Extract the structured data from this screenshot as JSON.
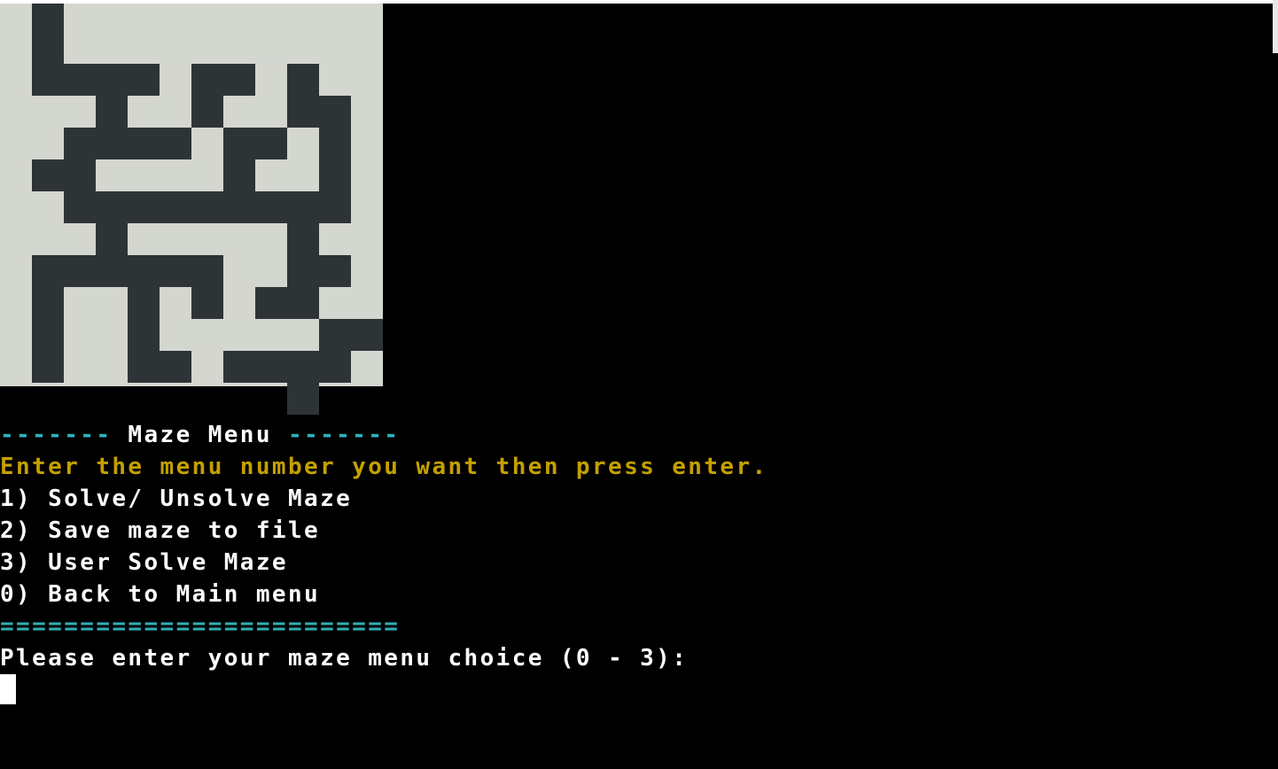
{
  "maze": {
    "cell_size": 36,
    "grid": [
      "............",
      ".#..........",
      ".####.##.#..",
      "...#..#..##.",
      "..####.##.#.",
      ".##....#..#.",
      "..#########.",
      "...#.....#..",
      ".######..##.",
      ".#..#.#.##..",
      ".#..#.....##",
      ".#..##.####.",
      ".........#.."
    ],
    "wall_color": "#2e3436",
    "floor_color": "#d4d6d0"
  },
  "menu": {
    "header_left": "-------",
    "header_title": " Maze Menu ",
    "header_right": "-------",
    "instruction": "Enter the menu number you want then press enter.",
    "options": [
      "1) Solve/ Unsolve Maze",
      "2) Save maze to file",
      "3) User Solve Maze",
      "0) Back to Main menu"
    ],
    "separator": "=========================",
    "prompt": "Please enter your maze menu choice (0 - 3):"
  },
  "colors": {
    "background": "#000000",
    "accent_teal": "#34aeb8",
    "accent_gold": "#c4a000",
    "text": "#ffffff"
  }
}
